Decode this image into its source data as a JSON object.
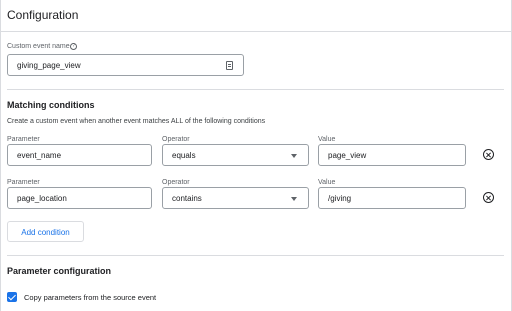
{
  "header": {
    "title": "Configuration"
  },
  "custom_event": {
    "label": "Custom event name",
    "help_icon": "help-circle-icon",
    "value": "giving_page_view",
    "value_icon": "document-icon"
  },
  "matching": {
    "title": "Matching conditions",
    "description": "Create a custom event when another event matches ALL of the following conditions",
    "column_labels": {
      "parameter": "Parameter",
      "operator": "Operator",
      "value": "Value"
    },
    "conditions": [
      {
        "parameter": "event_name",
        "operator": "equals",
        "value": "page_view"
      },
      {
        "parameter": "page_location",
        "operator": "contains",
        "value": "/giving"
      }
    ],
    "remove_icon": "remove-circle-icon",
    "add_label": "Add condition"
  },
  "param_config": {
    "title": "Parameter configuration",
    "checkbox_label": "Copy parameters from the source event",
    "checkbox_checked": true
  },
  "colors": {
    "accent": "#1a73e8",
    "border": "#dadce0",
    "text": "#202124"
  }
}
